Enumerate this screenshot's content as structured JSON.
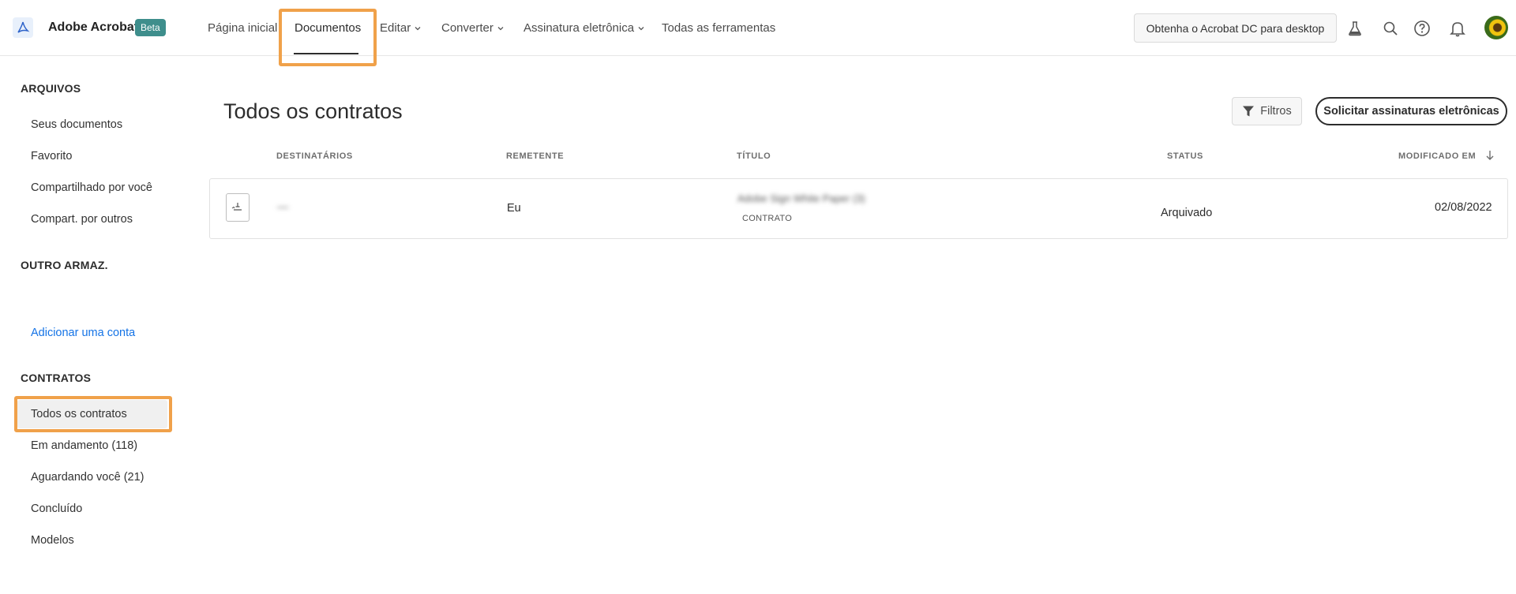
{
  "header": {
    "brand": "Adobe Acrobat",
    "badge": "Beta",
    "nav": [
      {
        "label": "Página inicial"
      },
      {
        "label": "Documentos"
      },
      {
        "label": "Editar"
      },
      {
        "label": "Converter"
      },
      {
        "label": "Assinatura eletrônica"
      },
      {
        "label": "Todas as ferramentas"
      }
    ],
    "cta": "Obtenha o Acrobat DC para desktop",
    "icons": [
      "flask-icon",
      "search-icon",
      "help-icon",
      "bell-icon",
      "avatar"
    ]
  },
  "sidebar": {
    "arquivos_title": "ARQUIVOS",
    "arquivos": [
      {
        "label": "Seus documentos"
      },
      {
        "label": "Favorito"
      },
      {
        "label": "Compartilhado por você"
      },
      {
        "label": "Compart. por outros"
      }
    ],
    "outro_title": "OUTRO ARMAZ.",
    "add_account": "Adicionar uma conta",
    "contratos_title": "CONTRATOS",
    "contratos": [
      {
        "label": "Todos os contratos"
      },
      {
        "label": "Em andamento (118)"
      },
      {
        "label": "Aguardando você (21)"
      },
      {
        "label": "Concluído"
      },
      {
        "label": "Modelos"
      }
    ]
  },
  "main": {
    "title": "Todos os contratos",
    "filter_label": "Filtros",
    "primary_button": "Solicitar assinaturas eletrônicas",
    "columns": [
      "DESTINATÁRIOS",
      "REMETENTE",
      "TÍTULO",
      "STATUS",
      "MODIFICADO EM"
    ],
    "rows": [
      {
        "recipient": "—",
        "sender": "Eu",
        "title": "Adobe Sign White Paper (3)",
        "type": "CONTRATO",
        "status": "Arquivado",
        "modified": "02/08/2022"
      }
    ]
  },
  "colors": {
    "accent_highlight": "#f0a14a",
    "link": "#1473e6",
    "beta_badge": "#3e8e8c"
  }
}
